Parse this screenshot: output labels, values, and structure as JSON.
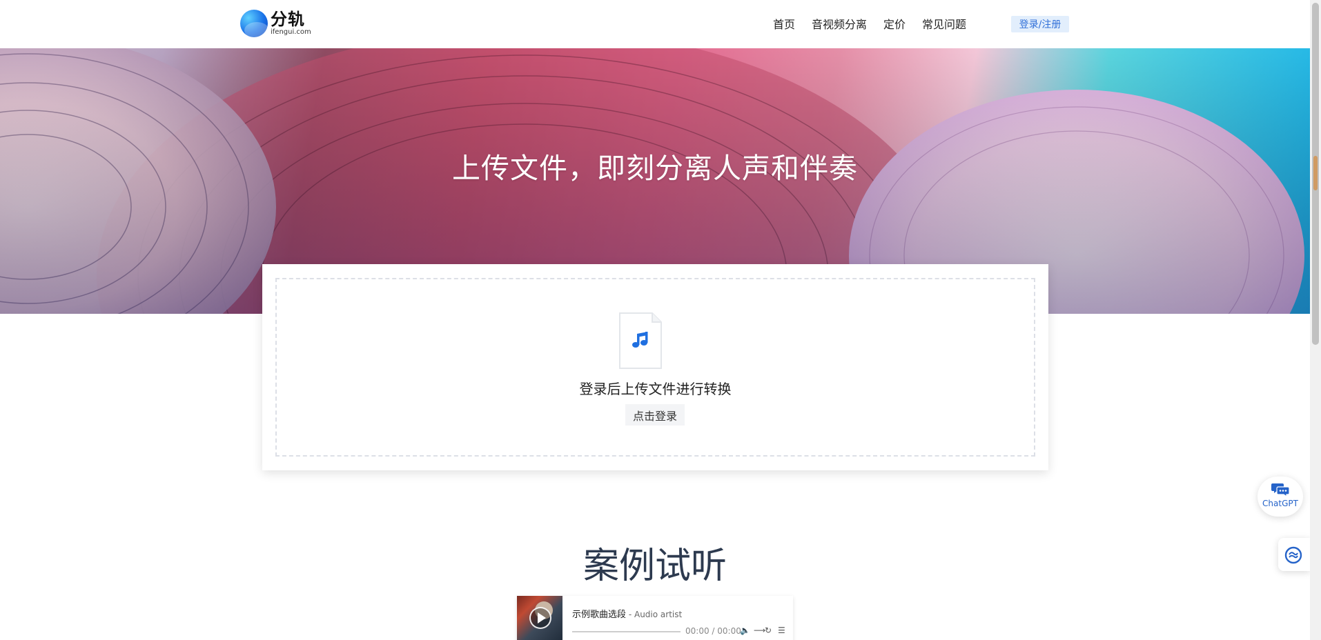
{
  "header": {
    "logo_cn": "分轨",
    "logo_en": "ifengui.com",
    "nav": [
      "首页",
      "音视频分离",
      "定价",
      "常见问题"
    ],
    "login_label": "登录/注册"
  },
  "hero": {
    "title": "上传文件，即刻分离人声和伴奏"
  },
  "upload": {
    "prompt": "登录后上传文件进行转换",
    "button_label": "点击登录",
    "icon": "music-file-icon"
  },
  "samples": {
    "title": "案例试听",
    "player": {
      "song": "示例歌曲选段",
      "separator": " - ",
      "artist": "Audio artist",
      "time": "00:00 / 00:00"
    }
  },
  "floating": {
    "chatgpt_label": "ChatGPT",
    "chatgpt_icon": "chat-bubbles-icon",
    "side_icon": "translate-icon"
  },
  "colors": {
    "accent": "#2f6fd8",
    "login_bg": "#e2eefc",
    "title": "#2d3a4f"
  }
}
